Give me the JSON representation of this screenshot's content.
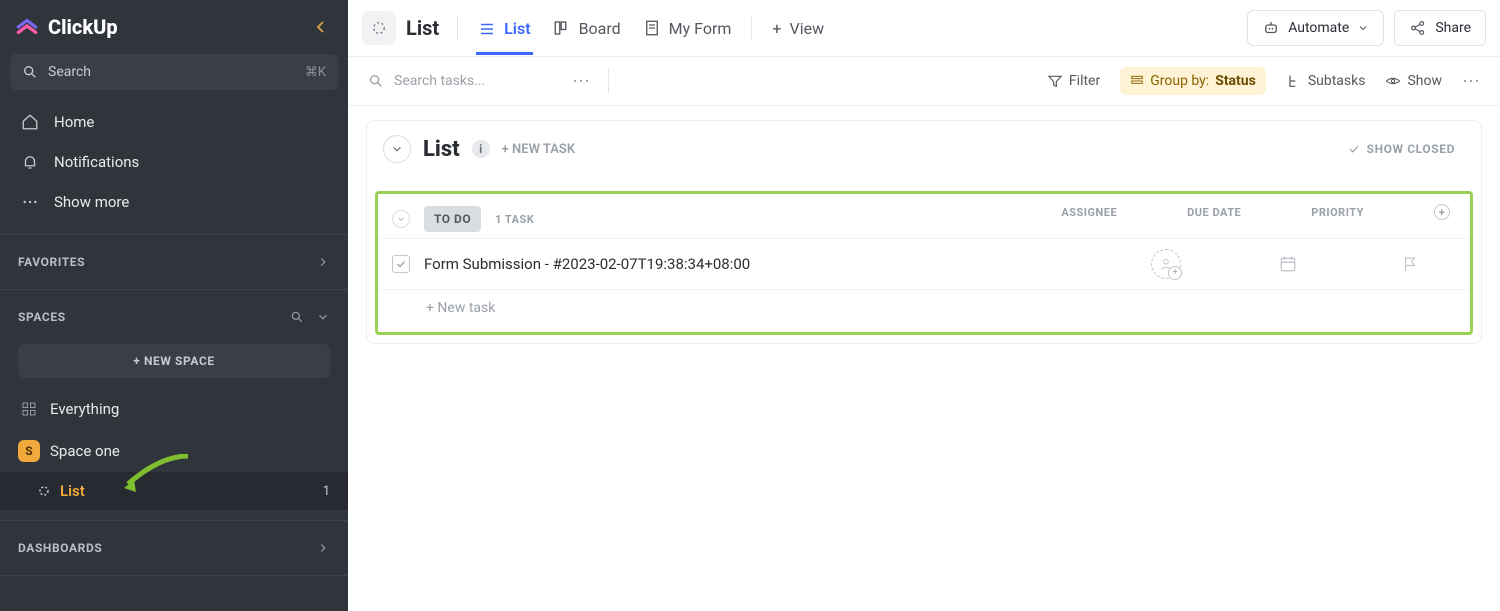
{
  "brand": "ClickUp",
  "sidebar": {
    "search_placeholder": "Search",
    "shortcut": "⌘K",
    "nav": [
      {
        "label": "Home"
      },
      {
        "label": "Notifications"
      },
      {
        "label": "Show more"
      }
    ],
    "favorites_label": "FAVORITES",
    "spaces_label": "SPACES",
    "new_space_label": "NEW SPACE",
    "everything_label": "Everything",
    "space": {
      "initial": "S",
      "name": "Space one"
    },
    "list": {
      "name": "List",
      "count": "1"
    },
    "dashboards_label": "DASHBOARDS"
  },
  "header": {
    "title": "List",
    "tabs": [
      {
        "label": "List"
      },
      {
        "label": "Board"
      },
      {
        "label": "My Form"
      }
    ],
    "view_label": "View",
    "automate_label": "Automate",
    "share_label": "Share"
  },
  "toolbar": {
    "search_placeholder": "Search tasks...",
    "filter_label": "Filter",
    "group_prefix": "Group by:",
    "group_value": "Status",
    "subtasks_label": "Subtasks",
    "show_label": "Show"
  },
  "panel": {
    "title": "List",
    "new_task_label": "+ NEW TASK",
    "show_closed_label": "SHOW CLOSED"
  },
  "status": {
    "name": "TO DO",
    "task_count": "1 TASK",
    "columns": [
      "ASSIGNEE",
      "DUE DATE",
      "PRIORITY"
    ],
    "task_name": "Form Submission - #2023-02-07T19:38:34+08:00",
    "add_task_label": "+ New task"
  }
}
